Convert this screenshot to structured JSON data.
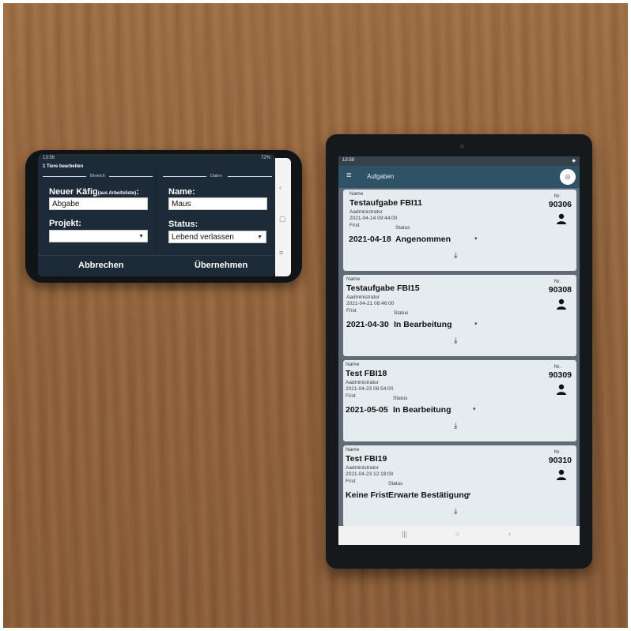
{
  "phone": {
    "status_time": "13:56",
    "status_right": "72%",
    "dialog_title": "1 Tiere bearbeiten",
    "section_left": "Bereich",
    "section_right": "Daten",
    "cage_label": "Neuer Käfig",
    "cage_hint": "(aus Arbeitsliste)",
    "cage_colon": ":",
    "cage_value": "Abgabe",
    "name_label": "Name:",
    "name_value": "Maus",
    "project_label": "Projekt:",
    "project_value": "",
    "status_label": "Status:",
    "status_value": "Lebend verlassen",
    "cancel_button": "Abbrechen",
    "accept_button": "Übernehmen"
  },
  "tablet": {
    "status_time": "13:58",
    "app_title": "Aufgaben",
    "name_caption": "Name",
    "nr_caption": "Nr.",
    "frist_caption": "Frist",
    "status_caption": "Status",
    "cards": [
      {
        "title": "Testaufgabe FBI11",
        "nr": "90306",
        "creator": "Aadministrator",
        "created": "2021-04-14 09:44:00",
        "frist": "2021-04-18",
        "status": "Angenommen"
      },
      {
        "title": "Testaufgabe FBI15",
        "nr": "90308",
        "creator": "Aadministrator",
        "created": "2021-04-21 08:46:00",
        "frist": "2021-04-30",
        "status": "In Bearbeitung"
      },
      {
        "title": "Test FBI18",
        "nr": "90309",
        "creator": "Aadministrator",
        "created": "2021-04-23 08:54:00",
        "frist": "2021-05-05",
        "status": "In Bearbeitung"
      },
      {
        "title": "Test FBI19",
        "nr": "90310",
        "creator": "Aadministrator",
        "created": "2021-04-23 12:18:00",
        "frist": "Keine Frist",
        "status": "Erwarte Bestätigung"
      }
    ]
  }
}
